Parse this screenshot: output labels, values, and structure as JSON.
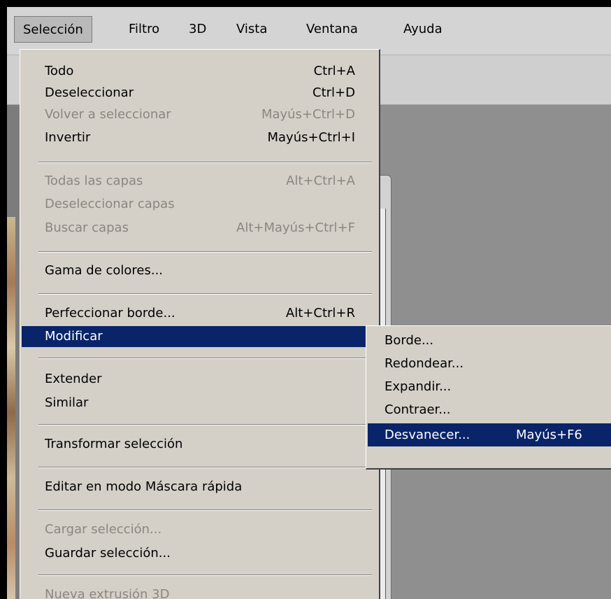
{
  "menubar": {
    "items": [
      {
        "label": "Selección",
        "active": true
      },
      {
        "label": "Filtro"
      },
      {
        "label": "3D"
      },
      {
        "label": "Vista"
      },
      {
        "label": "Ventana"
      },
      {
        "label": "Ayuda"
      }
    ]
  },
  "menu": {
    "items": [
      {
        "label": "Todo",
        "shortcut": "Ctrl+A",
        "enabled": true
      },
      {
        "label": "Deseleccionar",
        "shortcut": "Ctrl+D",
        "enabled": true
      },
      {
        "label": "Volver a seleccionar",
        "shortcut": "Mayús+Ctrl+D",
        "enabled": false
      },
      {
        "label": "Invertir",
        "shortcut": "Mayús+Ctrl+I",
        "enabled": true
      },
      {
        "label": "Todas las capas",
        "shortcut": "Alt+Ctrl+A",
        "enabled": false
      },
      {
        "label": "Deseleccionar capas",
        "shortcut": "",
        "enabled": false
      },
      {
        "label": "Buscar capas",
        "shortcut": "Alt+Mayús+Ctrl+F",
        "enabled": false
      },
      {
        "label": "Gama de colores...",
        "shortcut": "",
        "enabled": true
      },
      {
        "label": "Perfeccionar borde...",
        "shortcut": "Alt+Ctrl+R",
        "enabled": true
      },
      {
        "label": "Modificar",
        "shortcut": "",
        "enabled": true,
        "highlighted": true,
        "submenu": true
      },
      {
        "label": "Extender",
        "shortcut": "",
        "enabled": true
      },
      {
        "label": "Similar",
        "shortcut": "",
        "enabled": true
      },
      {
        "label": "Transformar selección",
        "shortcut": "",
        "enabled": true
      },
      {
        "label": "Editar en modo Máscara rápida",
        "shortcut": "",
        "enabled": true
      },
      {
        "label": "Cargar selección...",
        "shortcut": "",
        "enabled": false
      },
      {
        "label": "Guardar selección...",
        "shortcut": "",
        "enabled": true
      },
      {
        "label": "Nueva extrusión 3D",
        "shortcut": "",
        "enabled": false
      }
    ]
  },
  "submenu": {
    "items": [
      {
        "label": "Borde...",
        "shortcut": ""
      },
      {
        "label": "Redondear...",
        "shortcut": ""
      },
      {
        "label": "Expandir...",
        "shortcut": ""
      },
      {
        "label": "Contraer...",
        "shortcut": ""
      },
      {
        "label": "Desvanecer...",
        "shortcut": "Mayús+F6",
        "highlighted": true
      }
    ]
  },
  "colors": {
    "highlight": "#0a246a",
    "menu_bg": "#d4d0c8",
    "disabled_text": "#8a8780"
  }
}
